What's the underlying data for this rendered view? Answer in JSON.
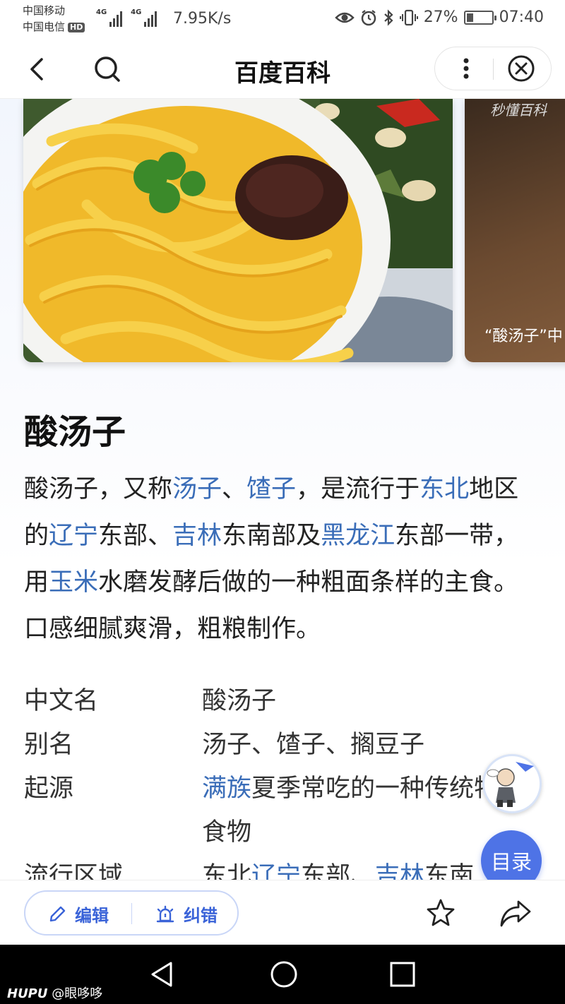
{
  "status_bar": {
    "carrier1": "中国移动",
    "carrier2": "中国电信",
    "hd": "HD",
    "net_type_1": "4G",
    "net_type_2": "4G",
    "net_speed": "7.95K/s",
    "battery": "27%",
    "battery_level": 0.27,
    "time": "07:40",
    "icons": [
      "eye-icon",
      "alarm-icon",
      "bluetooth-icon",
      "vibrate-icon",
      "battery-icon"
    ]
  },
  "header": {
    "title": "百度百科",
    "back_icon": "chevron-left-icon",
    "search_icon": "search-icon",
    "more_icon": "more-vertical-icon",
    "close_icon": "close-circle-icon"
  },
  "gallery": {
    "second_caption": "“酸汤子”中",
    "second_watermark": "秒懂百科"
  },
  "entry": {
    "title": "酸汤子",
    "summary": [
      {
        "t": "酸汤子，又称"
      },
      {
        "t": "汤子",
        "link": true
      },
      {
        "t": "、"
      },
      {
        "t": "馇子",
        "link": true
      },
      {
        "t": "，是流行于"
      },
      {
        "t": "东北",
        "link": true
      },
      {
        "t": "地区的"
      },
      {
        "t": "辽宁",
        "link": true
      },
      {
        "t": "东部、"
      },
      {
        "t": "吉林",
        "link": true
      },
      {
        "t": "东南部及"
      },
      {
        "t": "黑龙江",
        "link": true
      },
      {
        "t": "东部一带，用"
      },
      {
        "t": "玉米",
        "link": true
      },
      {
        "t": "水磨发酵后做的一种粗面条样的主食。口感细腻爽滑，粗粮制作。"
      }
    ]
  },
  "basic_info": [
    {
      "key": "中文名",
      "value": [
        {
          "t": "酸汤子"
        }
      ]
    },
    {
      "key": "别名",
      "value": [
        {
          "t": "汤子、馇子、搁豆子"
        }
      ]
    },
    {
      "key": "起源",
      "value": [
        {
          "t": "满族",
          "link": true
        },
        {
          "t": "夏季常吃的一种传统特色食物"
        }
      ]
    },
    {
      "key": "流行区域",
      "value": [
        {
          "t": "东北"
        },
        {
          "t": "辽宁",
          "link": true
        },
        {
          "t": "东部、"
        },
        {
          "t": "吉林",
          "link": true
        },
        {
          "t": "东南"
        }
      ]
    }
  ],
  "floating": {
    "toc_label": "目录"
  },
  "action_bar": {
    "edit_label": "编辑",
    "correct_label": "纠错",
    "star_icon": "star-icon",
    "share_icon": "share-icon"
  },
  "system_nav": {
    "watermark_brand": "HUPU",
    "watermark_user": "@眼哆哆"
  },
  "colors": {
    "link": "#3a6db8",
    "accent": "#4e73e6"
  }
}
